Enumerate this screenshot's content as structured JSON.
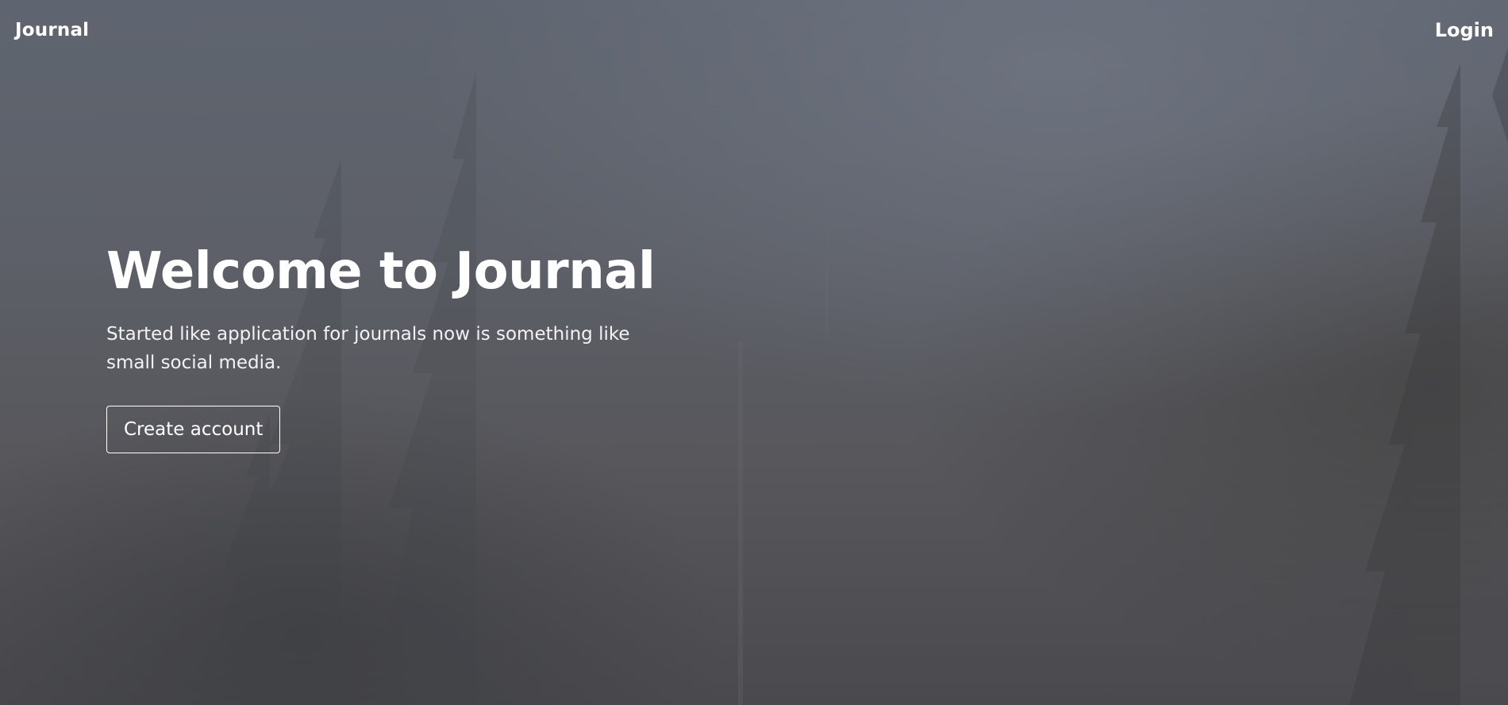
{
  "navbar": {
    "brand": "Journal",
    "login_label": "Login"
  },
  "hero": {
    "title": "Welcome to Journal",
    "subtitle": "Started like application for journals now is something like small social media.",
    "cta_label": "Create account",
    "background": "foggy-forest-image"
  },
  "colors": {
    "text": "#ffffff",
    "background_top": "#5f6570",
    "background_bottom": "#4a4a4e"
  }
}
